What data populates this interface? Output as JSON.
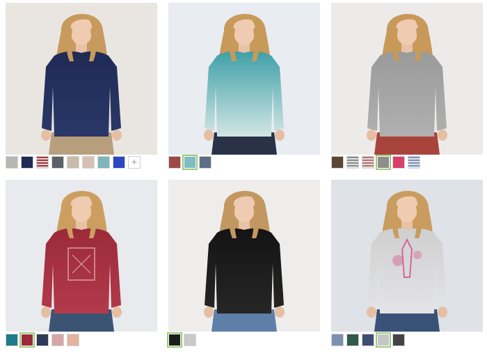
{
  "products": [
    {
      "id": "p1",
      "background": "#e9e6e2",
      "shirt": "#1f2a55",
      "shirt2": "#2a3868",
      "pants": "#b79f7e",
      "hair": "#c79a5d",
      "swatches": [
        {
          "name": "heather-gray",
          "color": "#b6b6b4"
        },
        {
          "name": "navy",
          "color": "#1f2a55"
        },
        {
          "name": "red-stripe",
          "color": "#9e3b3f",
          "stripe": true
        },
        {
          "name": "charcoal-print",
          "color": "#5c6068"
        },
        {
          "name": "oatmeal",
          "color": "#c8bba9"
        },
        {
          "name": "blush",
          "color": "#d8bfb6"
        },
        {
          "name": "teal",
          "color": "#7eb5bb"
        },
        {
          "name": "royal-blue",
          "color": "#2d47c3"
        }
      ],
      "more_label": "+"
    },
    {
      "id": "p2",
      "background": "#e9ecf1",
      "shirt": "#3fa0a8",
      "shirt2": "#d2e6e4",
      "pants": "#2a3248",
      "hair": "#c89a5a",
      "swatches": [
        {
          "name": "rust-ombre",
          "color": "#9e4a44"
        },
        {
          "name": "teal-ombre",
          "color": "#7fbcc4",
          "selected": true
        },
        {
          "name": "slate-ombre",
          "color": "#5d6f86"
        }
      ]
    },
    {
      "id": "p3",
      "background": "#ecebe9",
      "shirt": "#9a9a9a",
      "shirt2": "#b0b0b0",
      "pants": "#a9443d",
      "hair": "#c9995a",
      "swatches": [
        {
          "name": "brown",
          "color": "#5a4636"
        },
        {
          "name": "gray-stripe",
          "color": "#8a8a8a",
          "stripe": true
        },
        {
          "name": "rose-stripe",
          "color": "#b07272",
          "stripe": true
        },
        {
          "name": "heather-gray",
          "color": "#8e8e8c",
          "selected": true
        },
        {
          "name": "pink",
          "color": "#d84068"
        },
        {
          "name": "blue-stripe",
          "color": "#7f8fb3",
          "stripe": true
        }
      ]
    },
    {
      "id": "p4",
      "background": "#e8eaee",
      "shirt": "#9b2a39",
      "shirt2": "#b23a4a",
      "pants": "#3c5474",
      "hair": "#cc9f60",
      "swatches": [
        {
          "name": "teal",
          "color": "#1f7a8a"
        },
        {
          "name": "berry",
          "color": "#9b2a39",
          "selected": true
        },
        {
          "name": "navy-print",
          "color": "#2f3a55"
        },
        {
          "name": "pink-print",
          "color": "#d4a6a8"
        },
        {
          "name": "peach-print",
          "color": "#e3b39e"
        }
      ]
    },
    {
      "id": "p5",
      "background": "#eeedeb",
      "shirt": "#141414",
      "shirt2": "#262626",
      "pants": "#5e7fa8",
      "hair": "#c39860",
      "swatches": [
        {
          "name": "black",
          "color": "#1c1c1c",
          "selected": true
        },
        {
          "name": "light-gray",
          "color": "#c9c9c9"
        }
      ]
    },
    {
      "id": "p6",
      "background": "#dfe2e7",
      "shirt": "#cfcfd0",
      "shirt2": "#e4e4e6",
      "pants": "#3a5277",
      "hair": "#c99c5f",
      "graphic": "#d46a8e",
      "swatches": [
        {
          "name": "blue-floral",
          "color": "#7d8fb2"
        },
        {
          "name": "green-print",
          "color": "#2f5a4c"
        },
        {
          "name": "navy-floral",
          "color": "#3f4f72"
        },
        {
          "name": "light-gray-eiffel",
          "color": "#c5c6c8",
          "selected": true
        },
        {
          "name": "charcoal-print",
          "color": "#444448"
        }
      ]
    }
  ]
}
